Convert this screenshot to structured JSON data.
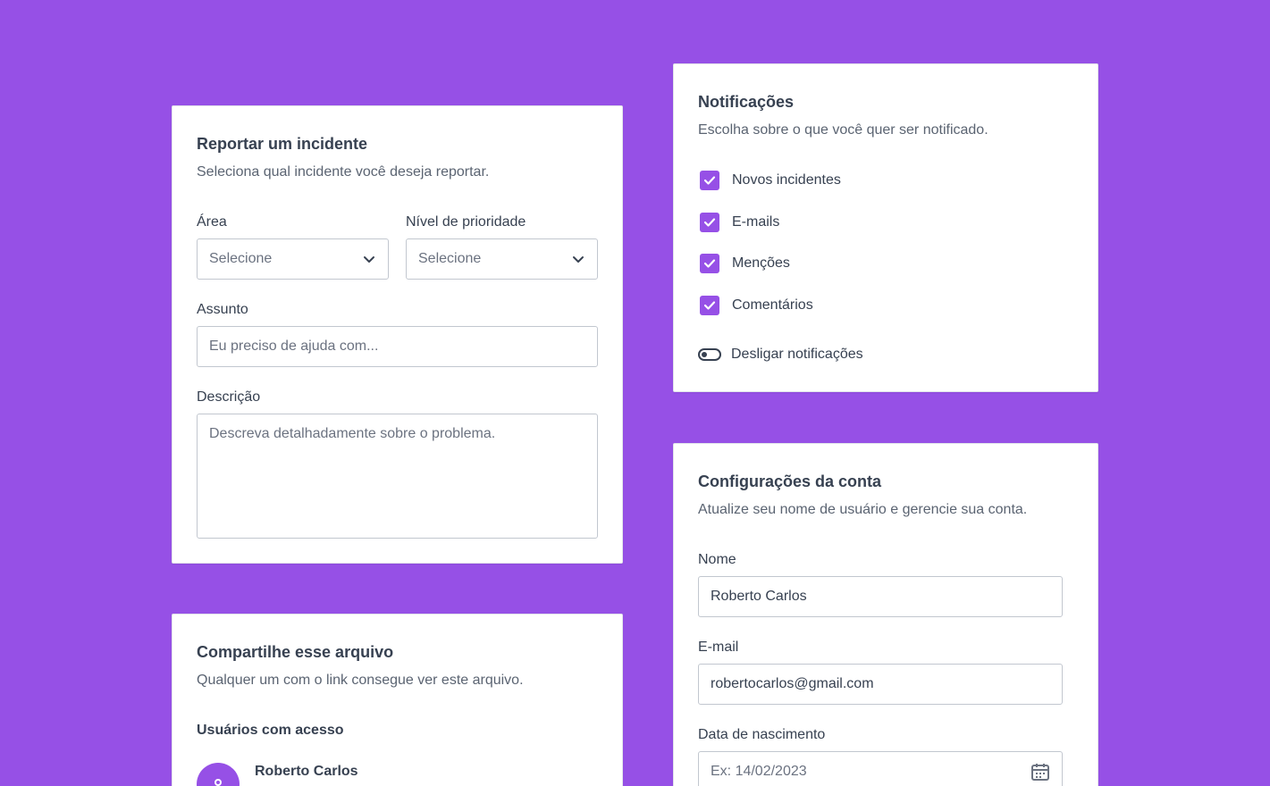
{
  "colors": {
    "background": "#9650e6",
    "accent": "#9650e6",
    "text": "#374151",
    "muted": "#5b6472"
  },
  "incident": {
    "title": "Reportar um incidente",
    "subtitle": "Seleciona qual incidente você deseja reportar.",
    "area_label": "Área",
    "area_value": "Selecione",
    "priority_label": "Nível de prioridade",
    "priority_value": "Selecione",
    "subject_label": "Assunto",
    "subject_placeholder": "Eu preciso de ajuda com...",
    "description_label": "Descrição",
    "description_placeholder": "Descreva detalhadamente sobre o problema."
  },
  "notifications": {
    "title": "Notificações",
    "subtitle": "Escolha sobre o que você quer ser notificado.",
    "options": [
      {
        "label": "Novos incidentes",
        "checked": true
      },
      {
        "label": "E-mails",
        "checked": true
      },
      {
        "label": "Menções",
        "checked": true
      },
      {
        "label": "Comentários",
        "checked": true
      }
    ],
    "toggle_label": "Desligar notificações"
  },
  "share": {
    "title": "Compartilhe esse arquivo",
    "subtitle": "Qualquer um com o link consegue ver este arquivo.",
    "users_label": "Usuários com acesso",
    "users": [
      {
        "name": "Roberto Carlos"
      }
    ]
  },
  "account": {
    "title": "Configurações da conta",
    "subtitle": "Atualize seu nome de usuário e gerencie sua conta.",
    "name_label": "Nome",
    "name_value": "Roberto Carlos",
    "email_label": "E-mail",
    "email_value": "robertocarlos@gmail.com",
    "birth_label": "Data de nascimento",
    "birth_placeholder": "Ex: 14/02/2023"
  }
}
